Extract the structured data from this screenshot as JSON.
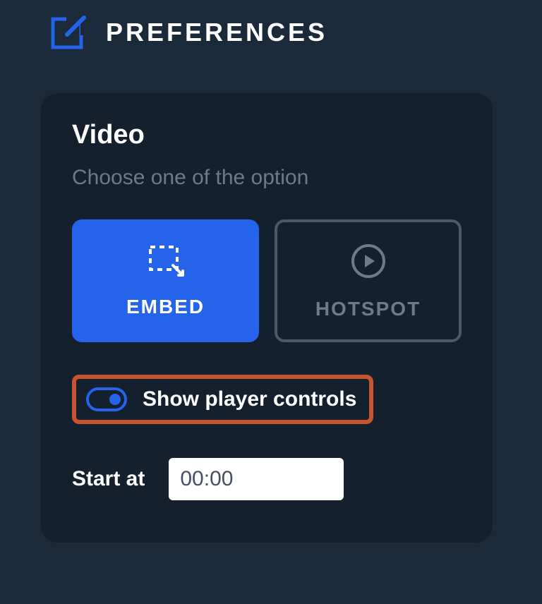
{
  "header": {
    "title": "PREFERENCES"
  },
  "video": {
    "title": "Video",
    "subtitle": "Choose one of the option",
    "options": {
      "embed_label": "EMBED",
      "hotspot_label": "HOTSPOT"
    },
    "toggle": {
      "label": "Show player controls",
      "on": true
    },
    "start": {
      "label": "Start at",
      "value": "00:00"
    }
  }
}
